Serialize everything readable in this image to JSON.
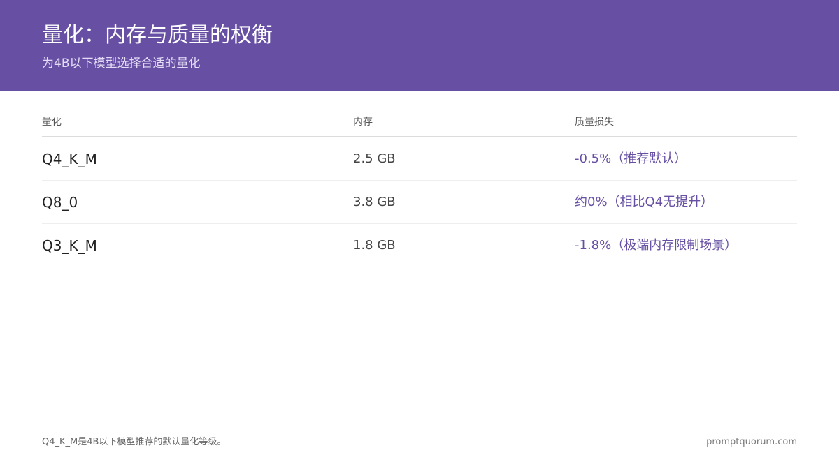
{
  "header": {
    "title": "量化：内存与质量的权衡",
    "subtitle": "为4B以下模型选择合适的量化"
  },
  "table": {
    "columns": [
      "量化",
      "内存",
      "质量损失"
    ],
    "rows": [
      {
        "quant": "Q4_K_M",
        "memory": "2.5 GB",
        "loss": "-0.5%（推荐默认）"
      },
      {
        "quant": "Q8_0",
        "memory": "3.8 GB",
        "loss": "约0%（相比Q4无提升）"
      },
      {
        "quant": "Q3_K_M",
        "memory": "1.8 GB",
        "loss": "-1.8%（极端内存限制场景）"
      }
    ]
  },
  "footer": {
    "note": "Q4_K_M是4B以下模型推荐的默认量化等级。",
    "site": "promptquorum.com"
  },
  "colors": {
    "accent": "#6750a4",
    "header_bg": "#6750a4"
  }
}
